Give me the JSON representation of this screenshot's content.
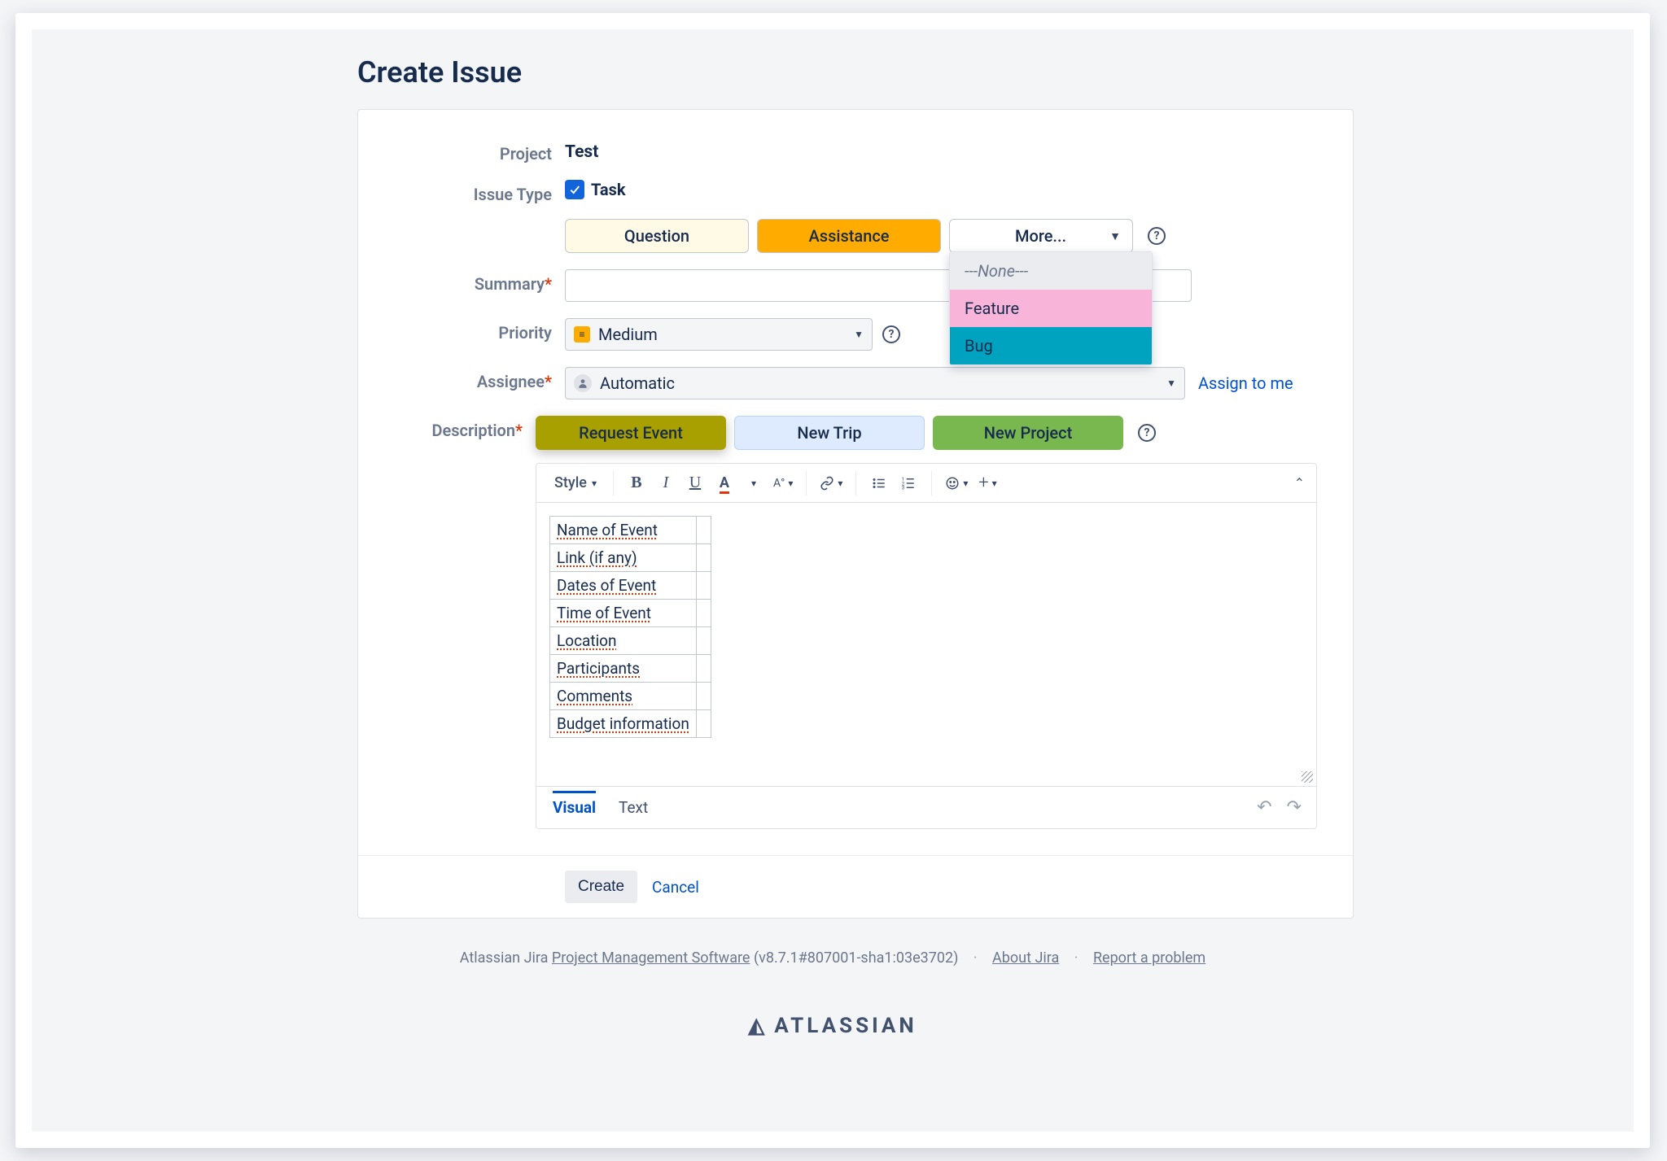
{
  "title": "Create Issue",
  "form": {
    "project_label": "Project",
    "project_value": "Test",
    "issue_type_label": "Issue Type",
    "issue_type_value": "Task",
    "pills": {
      "question": "Question",
      "assistance": "Assistance",
      "more": "More..."
    },
    "more_menu": {
      "none": "---None---",
      "feature": "Feature",
      "bug": "Bug"
    },
    "summary_label": "Summary",
    "priority_label": "Priority",
    "priority_value": "Medium",
    "assignee_label": "Assignee",
    "assignee_value": "Automatic",
    "assign_to_me": "Assign to me",
    "description_label": "Description",
    "desc_pills": {
      "request_event": "Request Event",
      "new_trip": "New Trip",
      "new_project": "New Project"
    }
  },
  "editor": {
    "style_label": "Style",
    "table_rows": [
      "Name of Event",
      "Link (if any)",
      "Dates of Event",
      "Time of Event",
      "Location",
      "Participants",
      "Comments",
      "Budget information"
    ],
    "tabs": {
      "visual": "Visual",
      "text": "Text"
    }
  },
  "actions": {
    "create": "Create",
    "cancel": "Cancel"
  },
  "footer": {
    "prefix": "Atlassian Jira ",
    "link1": "Project Management Software",
    "version": " (v8.7.1#807001-sha1:03e3702)",
    "about": "About Jira",
    "report": "Report a problem",
    "brand": "ATLASSIAN"
  }
}
